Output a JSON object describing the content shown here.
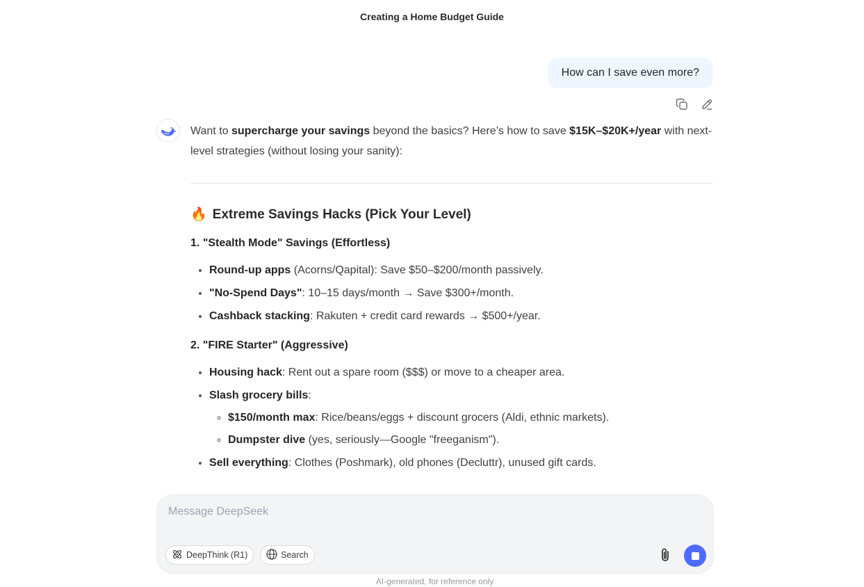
{
  "header": {
    "title": "Creating a Home Budget Guide"
  },
  "user_message": {
    "text": "How can I save even more?"
  },
  "message_actions": {
    "copy_icon": "copy-icon",
    "edit_icon": "edit-icon"
  },
  "assistant": {
    "avatar_icon": "whale-logo-icon",
    "intro": {
      "part1": "Want to ",
      "bold1": "supercharge your savings",
      "part2": " beyond the basics? Here’s how to save ",
      "bold2": "$15K–$20K+/year",
      "part3": " with next-level strategies (without losing your sanity):"
    },
    "heading": {
      "emoji": "🔥",
      "text": "Extreme Savings Hacks (Pick Your Level)"
    },
    "sections": [
      {
        "title": "1. \"Stealth Mode\" Savings (Effortless)",
        "items": [
          {
            "bold": "Round-up apps",
            "text": " (Acorns/Qapital): Save $50–$200/month passively."
          },
          {
            "bold": "\"No-Spend Days\"",
            "text": ": 10–15 days/month → Save $300+/month."
          },
          {
            "bold": "Cashback stacking",
            "text": ": Rakuten + credit card rewards → $500+/year."
          }
        ]
      },
      {
        "title": "2. \"FIRE Starter\" (Aggressive)",
        "items": [
          {
            "bold": "Housing hack",
            "text": ": Rent out a spare room ($$$) or move to a cheaper area."
          },
          {
            "bold": "Slash grocery bills",
            "text": ":",
            "subitems": [
              {
                "bold": "$150/month max",
                "text": ": Rice/beans/eggs + discount grocers (Aldi, ethnic markets)."
              },
              {
                "bold": "Dumpster dive",
                "text": " (yes, seriously—Google \"freeganism\")."
              }
            ]
          },
          {
            "bold": "Sell everything",
            "text": ": Clothes (Poshmark), old phones (Decluttr), unused gift cards."
          }
        ]
      }
    ]
  },
  "composer": {
    "placeholder": "Message DeepSeek",
    "deepthink_label": "DeepThink (R1)",
    "search_label": "Search",
    "attach_icon": "paperclip-icon",
    "stop_icon": "stop-icon",
    "accent": "#4d6bfe"
  },
  "footer": {
    "disclaimer": "AI-generated, for reference only"
  }
}
